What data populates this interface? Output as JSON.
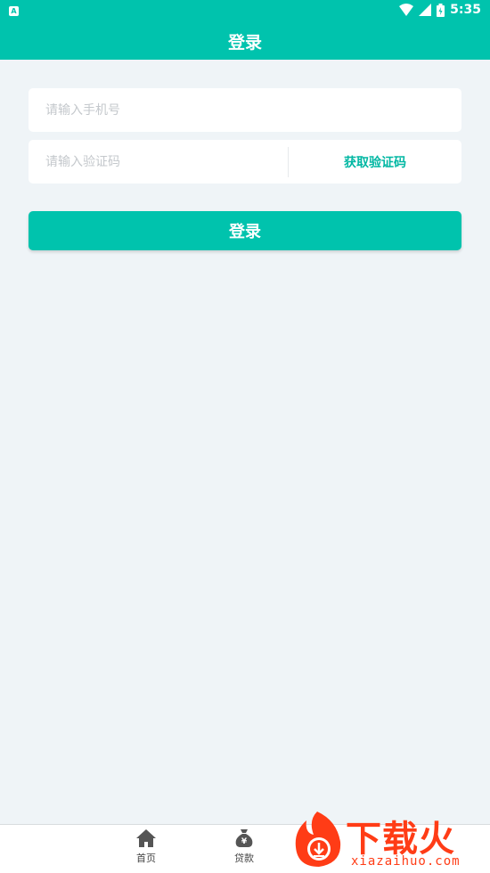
{
  "status_bar": {
    "time": "5:35",
    "app_indicator": "A"
  },
  "header": {
    "title": "登录"
  },
  "form": {
    "phone_placeholder": "请输入手机号",
    "code_placeholder": "请输入验证码",
    "get_code_label": "获取验证码",
    "login_label": "登录"
  },
  "tabbar": {
    "items": [
      {
        "label": "首页",
        "icon": "home-icon"
      },
      {
        "label": "贷款",
        "icon": "money-bag-icon"
      }
    ]
  },
  "watermark": {
    "brand": "下载火",
    "url": "xiazaihuo.com"
  },
  "colors": {
    "accent": "#00c3ad",
    "background": "#eff4f7",
    "watermark": "#ff3c16"
  }
}
